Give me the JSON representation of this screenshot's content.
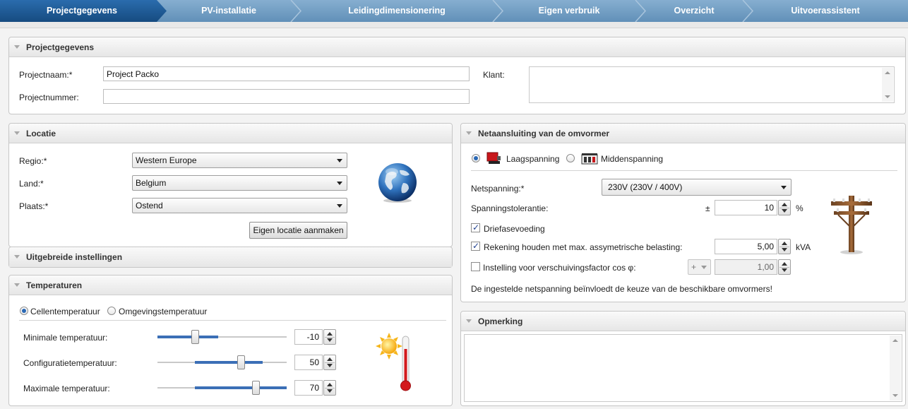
{
  "wizard": {
    "steps": [
      {
        "label": "Projectgegevens",
        "active": true
      },
      {
        "label": "PV-installatie",
        "active": false
      },
      {
        "label": "Leidingdimensionering",
        "active": false
      },
      {
        "label": "Eigen verbruik",
        "active": false
      },
      {
        "label": "Overzicht",
        "active": false
      },
      {
        "label": "Uitvoerassistent",
        "active": false
      }
    ],
    "colors": {
      "active": "#1c5a96",
      "inactive": "#6f9bbf"
    }
  },
  "project": {
    "title": "Projectgegevens",
    "name_label": "Projectnaam:*",
    "name_value": "Project Packo",
    "number_label": "Projectnummer:",
    "number_value": "",
    "client_label": "Klant:",
    "client_value": ""
  },
  "location": {
    "title": "Locatie",
    "region_label": "Regio:*",
    "region_value": "Western Europe",
    "country_label": "Land:*",
    "country_value": "Belgium",
    "place_label": "Plaats:*",
    "place_value": "Ostend",
    "create_button": "Eigen locatie aanmaken",
    "icon": "globe-icon"
  },
  "advanced": {
    "title": "Uitgebreide instellingen"
  },
  "temperatures": {
    "title": "Temperaturen",
    "radio_cell": "Cellentemperatuur",
    "radio_ambient": "Omgevingstemperatuur",
    "selected": "Cellentemperatuur",
    "min_label": "Minimale temperatuur:",
    "min_value": "-10",
    "config_label": "Configuratietemperatuur:",
    "config_value": "50",
    "max_label": "Maximale temperatuur:",
    "max_value": "70",
    "icon": "sun-thermometer-icon"
  },
  "grid": {
    "title": "Netaansluiting van de omvormer",
    "radio_low": "Laagspanning",
    "radio_medium": "Middenspanning",
    "selected": "Laagspanning",
    "voltage_label": "Netspanning:*",
    "voltage_value": "230V (230V / 400V)",
    "tolerance_label": "Spanningstolerantie:",
    "tolerance_prefix": "±",
    "tolerance_value": "10",
    "tolerance_unit": "%",
    "three_phase_label": "Driefasevoeding",
    "three_phase_checked": true,
    "asym_label": "Rekening houden met max. assymetrische belasting:",
    "asym_checked": true,
    "asym_value": "5,00",
    "asym_unit": "kVA",
    "cosphi_label": "Instelling voor verschuivingsfactor cos φ:",
    "cosphi_checked": false,
    "cosphi_sign": "+",
    "cosphi_value": "1,00",
    "note": "De ingestelde netspanning beïnvloedt de keuze van de beschikbare omvormers!",
    "icon": "utility-pole-icon"
  },
  "remark": {
    "title": "Opmerking",
    "value": ""
  }
}
